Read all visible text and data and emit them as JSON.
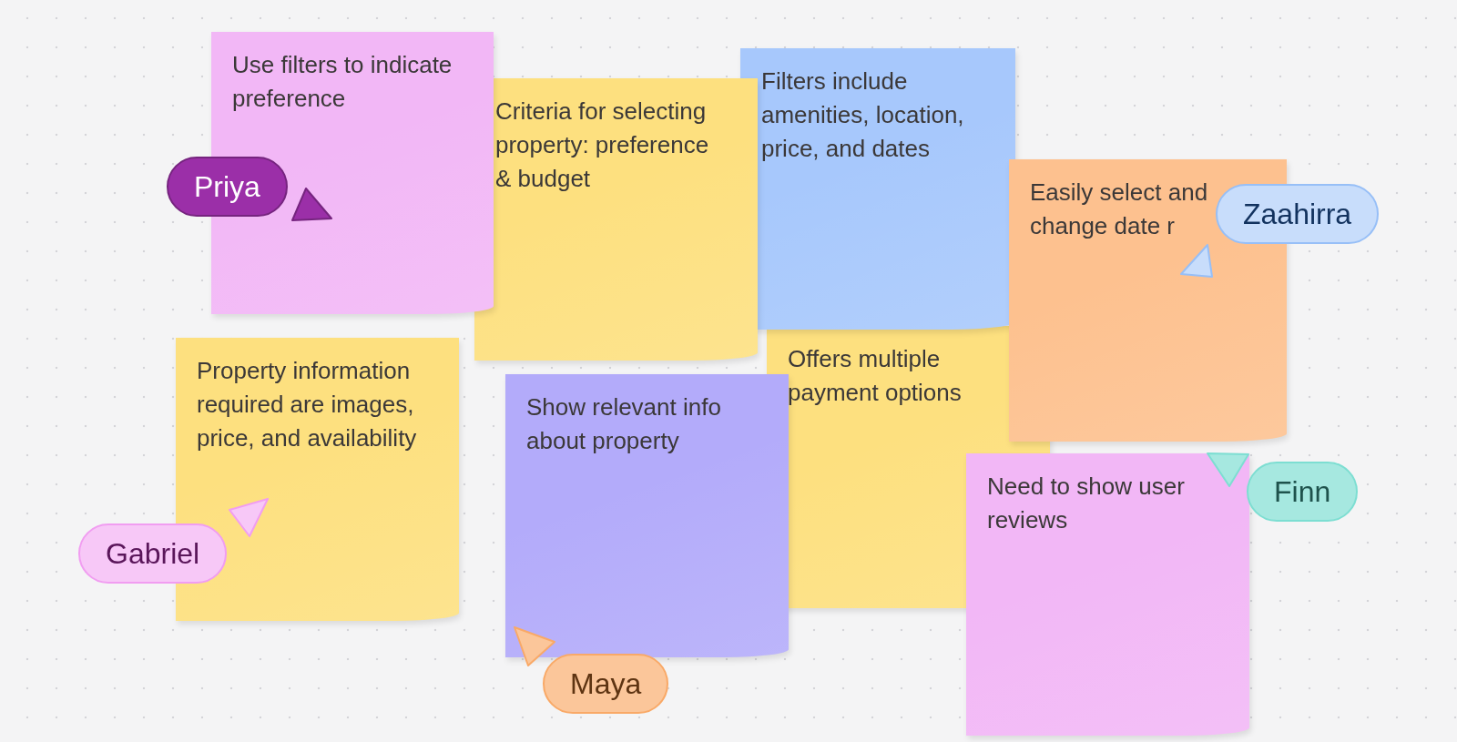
{
  "notes": [
    {
      "text": "Use filters to indicate preference",
      "color": "#f2b7f6"
    },
    {
      "text": "Criteria for selecting property: preference & budget",
      "color": "#fde07f"
    },
    {
      "text": "Filters include amenities, location, price, and dates",
      "color": "#a7c8fc"
    },
    {
      "text": "Easily select and change date r",
      "color": "#fdc18f"
    },
    {
      "text": "Property information required are images, price, and availability",
      "color": "#fde07f"
    },
    {
      "text": "Show relevant info about property",
      "color": "#b3abfa"
    },
    {
      "text": "Offers multiple payment options",
      "color": "#fde07f"
    },
    {
      "text": "Need to show user reviews",
      "color": "#f2b7f6"
    }
  ],
  "cursors": [
    {
      "name": "Priya",
      "color": "#9b2fa8"
    },
    {
      "name": "Zaahirra",
      "color": "#c8ddfb"
    },
    {
      "name": "Gabriel",
      "color": "#f7c8f7"
    },
    {
      "name": "Maya",
      "color": "#fbc69a"
    },
    {
      "name": "Finn",
      "color": "#a6e8e0"
    }
  ]
}
